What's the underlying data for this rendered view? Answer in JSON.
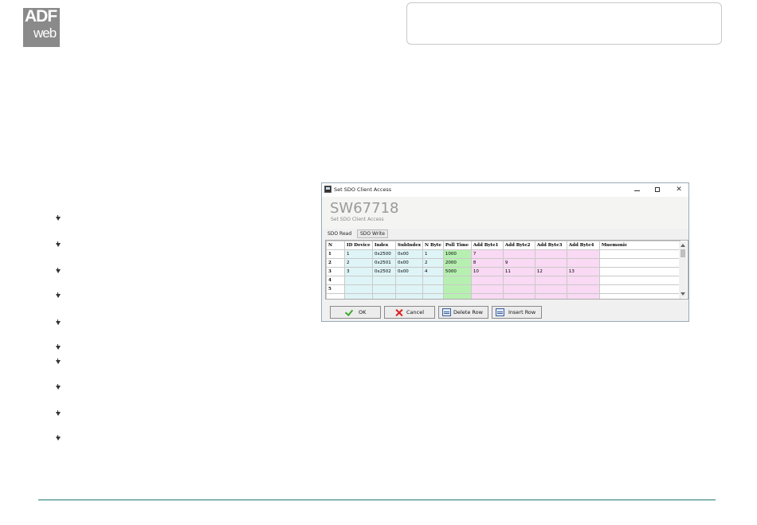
{
  "logo": {
    "line1": "ADF",
    "line2": "web"
  },
  "window": {
    "title": "Set SDO Client Access",
    "minimize": "",
    "maximize": "",
    "close": "✕",
    "heading": "SW67718",
    "subheading": "Set SDO Client Access",
    "tabs": [
      "SDO Read",
      "SDO Write"
    ],
    "columns": [
      "N",
      "ID Device",
      "Index",
      "SubIndex",
      "N Byte",
      "Poll Time",
      "Add Byte1",
      "Add Byte2",
      "Add Byte3",
      "Add Byte4",
      "Mnemonic"
    ],
    "rows": [
      [
        "1",
        "1",
        "0x2500",
        "0x00",
        "1",
        "1000",
        "7",
        "",
        "",
        "",
        ""
      ],
      [
        "2",
        "2",
        "0x2501",
        "0x00",
        "2",
        "2000",
        "8",
        "9",
        "",
        "",
        ""
      ],
      [
        "3",
        "3",
        "0x2502",
        "0x00",
        "4",
        "5000",
        "10",
        "11",
        "12",
        "13",
        ""
      ],
      [
        "4",
        "",
        "",
        "",
        "",
        "",
        "",
        "",
        "",
        "",
        ""
      ],
      [
        "5",
        "",
        "",
        "",
        "",
        "",
        "",
        "",
        "",
        "",
        ""
      ],
      [
        "",
        "",
        "",
        "",
        "",
        "",
        "",
        "",
        "",
        "",
        ""
      ]
    ],
    "buttons": {
      "ok": "OK",
      "cancel": "Cancel",
      "delete_row": "Delete Row",
      "insert_row": "Insert Row"
    }
  },
  "colors": {
    "footer_line": "#1f7a70",
    "cyan_col": "#dff4f6",
    "green_col": "#b6f0b0",
    "pink_col": "#f9d9f3"
  }
}
